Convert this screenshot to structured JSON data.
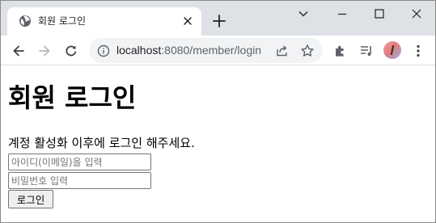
{
  "tab": {
    "title": "회원 로그인",
    "favicon": "globe-icon"
  },
  "toolbar": {
    "url_host": "localhost",
    "url_path": ":8080/member/login"
  },
  "page": {
    "heading": "회원 로그인",
    "notice": "계정 활성화 이후에 로그인 해주세요.",
    "email_placeholder": "아이디(이메일)을 입력",
    "password_placeholder": "비밀번호 입력",
    "login_button": "로그인"
  },
  "colors": {
    "tabstrip_bg": "#dee1e6",
    "omnibox_bg": "#f1f3f4",
    "icon_color": "#5f6368"
  }
}
